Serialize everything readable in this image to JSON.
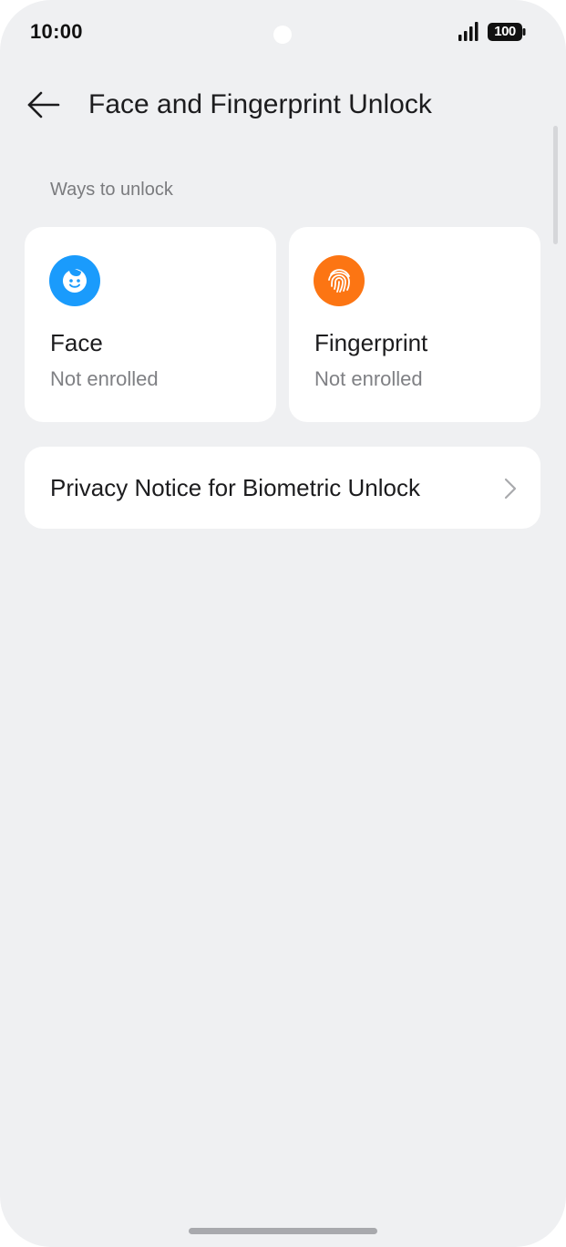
{
  "status_bar": {
    "time": "10:00",
    "battery": "100",
    "icons": [
      "signal-icon",
      "battery-icon"
    ]
  },
  "header": {
    "back_icon": "arrow-left-icon",
    "title": "Face and Fingerprint Unlock"
  },
  "section": {
    "title": "Ways to unlock"
  },
  "methods": [
    {
      "name": "Face",
      "status": "Not enrolled",
      "icon": "face-icon",
      "color": "#1a9bfc"
    },
    {
      "name": "Fingerprint",
      "status": "Not enrolled",
      "icon": "fingerprint-icon",
      "color": "#fc7513"
    }
  ],
  "privacy": {
    "label": "Privacy Notice for Biometric Unlock",
    "icon": "chevron-right-icon"
  }
}
